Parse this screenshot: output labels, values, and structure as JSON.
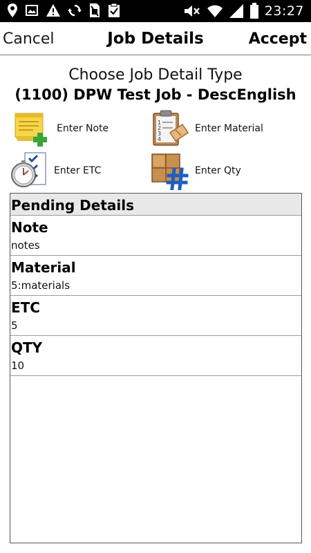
{
  "status_bar": {
    "time": "23:27",
    "left_icons": [
      "location-icon",
      "image-icon",
      "warning-icon",
      "sync-icon",
      "sim-off-icon",
      "clipboard-check-icon"
    ],
    "right_icons": [
      "mute-icon",
      "wifi-icon",
      "signal-icon",
      "battery-icon"
    ]
  },
  "nav": {
    "cancel_label": "Cancel",
    "title": "Job Details",
    "accept_label": "Accept"
  },
  "heading": {
    "choose": "Choose Job Detail Type",
    "job_name": "(1100) DPW Test Job - DescEnglish"
  },
  "actions": [
    {
      "label": "Enter Note",
      "icon": "note-add-icon"
    },
    {
      "label": "Enter Material",
      "icon": "clipboard-material-icon"
    },
    {
      "label": "Enter ETC",
      "icon": "stopwatch-checklist-icon"
    },
    {
      "label": "Enter Qty",
      "icon": "box-hash-icon"
    }
  ],
  "pending": {
    "header": "Pending Details",
    "items": [
      {
        "title": "Note",
        "value": "notes"
      },
      {
        "title": "Material",
        "value": "5:materials"
      },
      {
        "title": "ETC",
        "value": "5"
      },
      {
        "title": "QTY",
        "value": "10"
      }
    ]
  },
  "colors": {
    "status_bar_bg": "#000000",
    "nav_divider": "#6a8096",
    "pending_header_bg": "#e8e8e8"
  }
}
